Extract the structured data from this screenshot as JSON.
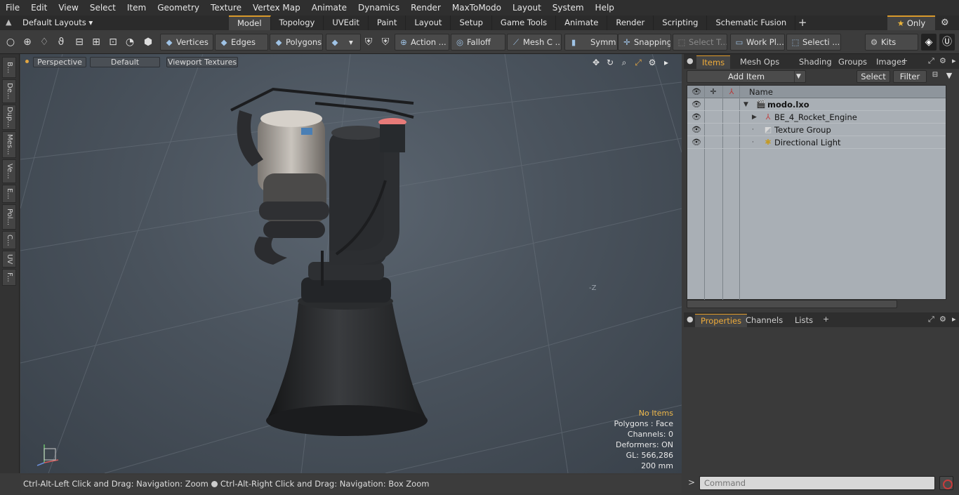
{
  "menu": [
    "File",
    "Edit",
    "View",
    "Select",
    "Item",
    "Geometry",
    "Texture",
    "Vertex Map",
    "Animate",
    "Dynamics",
    "Render",
    "MaxToModo",
    "Layout",
    "System",
    "Help"
  ],
  "layout": {
    "selector": "Default Layouts ▾",
    "tabs": [
      "Model",
      "Topology",
      "UVEdit",
      "Paint",
      "Layout",
      "Setup",
      "Game Tools",
      "Animate",
      "Render",
      "Scripting",
      "Schematic Fusion"
    ],
    "active_tab": "Model",
    "only_label": "Only"
  },
  "toolbar": {
    "vertices": "Vertices",
    "edges": "Edges",
    "polygons": "Polygons",
    "action": "Action ...",
    "falloff": "Falloff",
    "mesh": "Mesh C ...",
    "symm": "Symm ...",
    "snapping": "Snapping",
    "select_t": "Select T...",
    "work_pl": "Work Pl...",
    "selecti": "Selecti ...",
    "kits": "Kits"
  },
  "left_palette": [
    "B...",
    "De...",
    "Dup...",
    "Mes...",
    "Ve...",
    "E...",
    "Pol...",
    "C...",
    "UV",
    "F..."
  ],
  "viewport": {
    "view_mode": "Perspective",
    "shading": "Default",
    "textures": "Viewport Textures",
    "axis_hint": "-Z",
    "stats": {
      "no_items": "No Items",
      "polygons": "Polygons : Face",
      "channels": "Channels: 0",
      "deformers": "Deformers: ON",
      "gl": "GL: 566,286",
      "scale": "200 mm"
    }
  },
  "status": {
    "left": "Ctrl-Alt-Left Click and Drag: Navigation: Zoom",
    "right": "Ctrl-Alt-Right Click and Drag: Navigation: Box Zoom"
  },
  "items_panel": {
    "tabs": [
      "Items",
      "Mesh Ops",
      "Shading",
      "Groups",
      "Images"
    ],
    "active_tab": "Items",
    "add_item": "Add Item",
    "select": "Select",
    "filter": "Filter",
    "col_name": "Name",
    "tree": [
      {
        "label": "modo.lxo",
        "bold": true
      },
      {
        "label": "BE_4_Rocket_Engine",
        "bold": false
      },
      {
        "label": "Texture Group",
        "bold": false
      },
      {
        "label": "Directional Light",
        "bold": false
      }
    ]
  },
  "props_panel": {
    "tabs": [
      "Properties",
      "Channels",
      "Lists"
    ],
    "active_tab": "Properties"
  },
  "command": {
    "placeholder": "Command"
  },
  "colors": {
    "accent": "#e09b2a",
    "tree_bg": "#a9afb5",
    "viewport_center": "#5b6570"
  }
}
